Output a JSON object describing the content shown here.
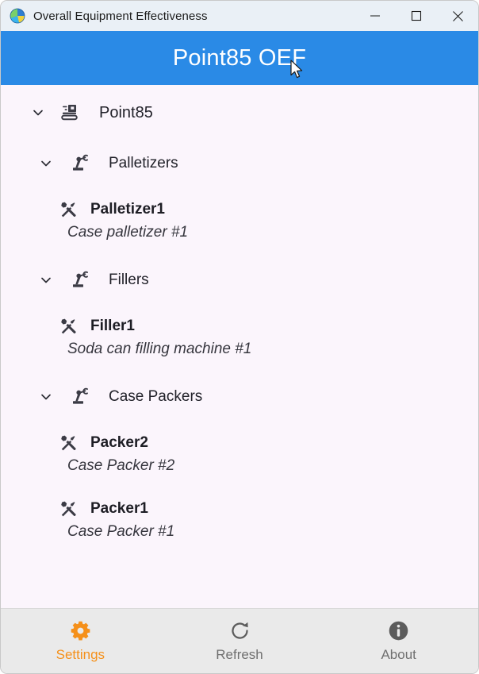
{
  "window": {
    "title": "Overall Equipment Effectiveness",
    "app_icon": "pie-chart-globe-icon",
    "controls": {
      "minimize": "minimize-button",
      "maximize": "maximize-button",
      "close": "close-button"
    }
  },
  "header": {
    "title": "Point85 OEF",
    "background": "#2a8ae6",
    "text_color": "#ffffff"
  },
  "tree": {
    "background": "#fbf5fc",
    "root": {
      "label": "Point85",
      "icon": "factory-plant-icon",
      "chevron": "chevron-down-icon",
      "expanded": true
    },
    "groups": [
      {
        "label": "Palletizers",
        "icon": "robot-arm-icon",
        "chevron": "chevron-down-icon",
        "expanded": true,
        "equipment": [
          {
            "name": "Palletizer1",
            "description": "Case palletizer #1",
            "icon": "tools-icon"
          }
        ]
      },
      {
        "label": "Fillers",
        "icon": "robot-arm-icon",
        "chevron": "chevron-down-icon",
        "expanded": true,
        "equipment": [
          {
            "name": "Filler1",
            "description": "Soda can filling machine #1",
            "icon": "tools-icon"
          }
        ]
      },
      {
        "label": "Case Packers",
        "icon": "robot-arm-icon",
        "chevron": "chevron-down-icon",
        "expanded": true,
        "equipment": [
          {
            "name": "Packer2",
            "description": "Case Packer #2",
            "icon": "tools-icon"
          },
          {
            "name": "Packer1",
            "description": "Case Packer #1",
            "icon": "tools-icon"
          }
        ]
      }
    ]
  },
  "toolbar": {
    "background": "#eaeaea",
    "active_color": "#f5901a",
    "inactive_color": "#6f6f6f",
    "items": [
      {
        "label": "Settings",
        "icon": "gear-icon",
        "active": true
      },
      {
        "label": "Refresh",
        "icon": "refresh-icon",
        "active": false
      },
      {
        "label": "About",
        "icon": "info-icon",
        "active": false
      }
    ]
  }
}
